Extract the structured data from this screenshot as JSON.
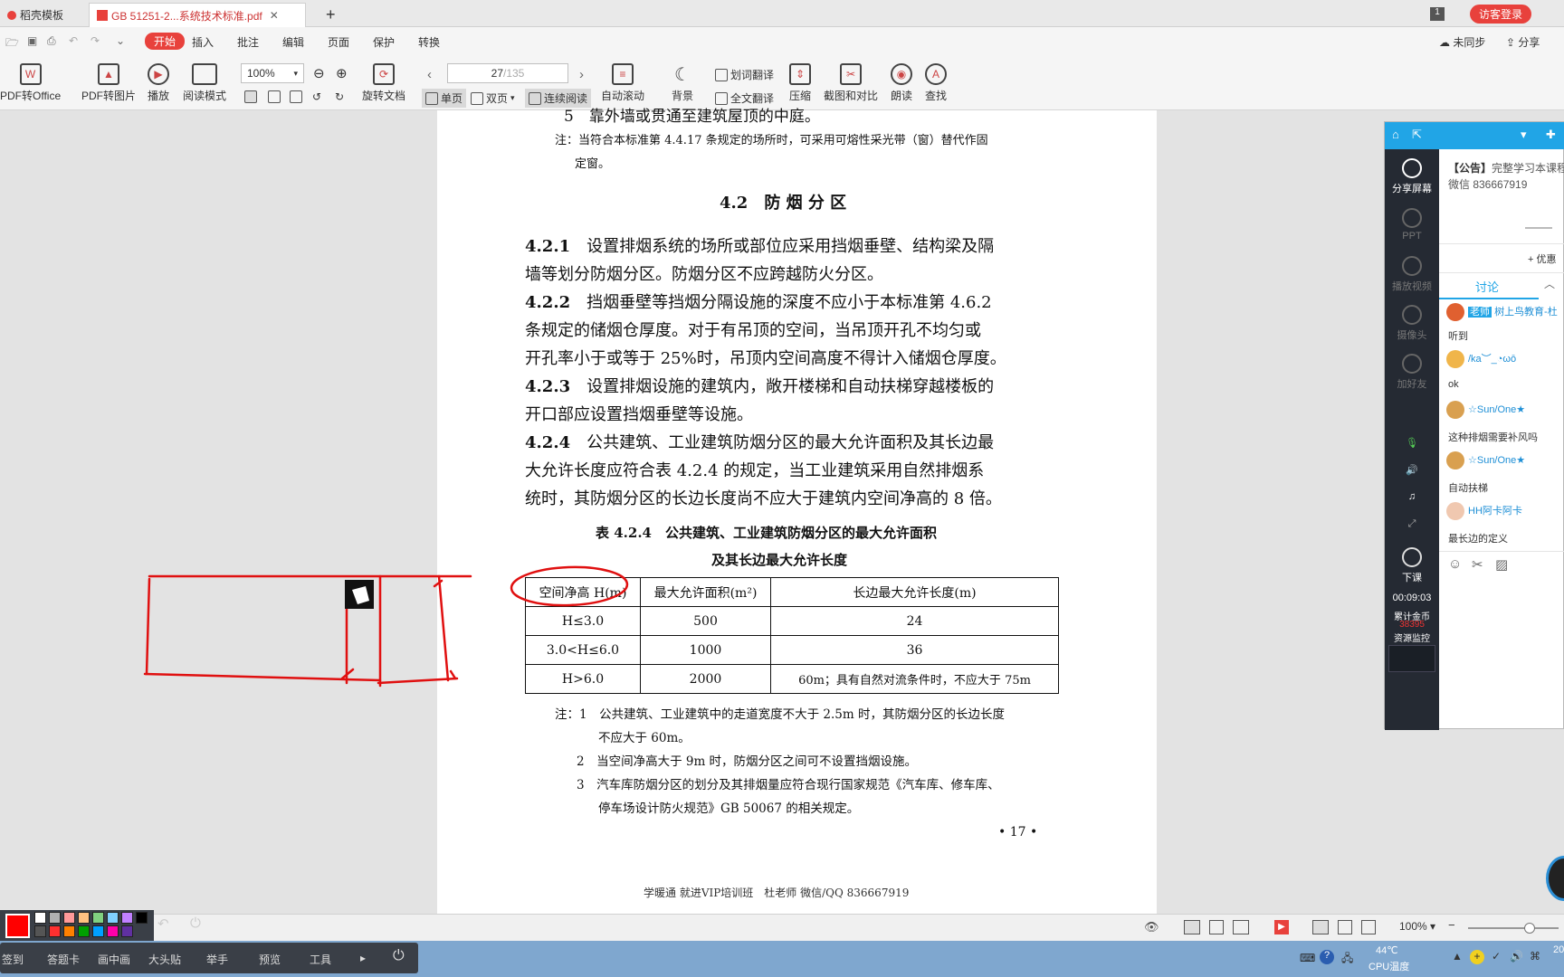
{
  "tabs": {
    "home": "稻壳模板",
    "pdf": "GB 51251-2...系统技术标准.pdf",
    "add": "+",
    "badge": "1",
    "login": "访客登录"
  },
  "menu": {
    "items": [
      "开始",
      "插入",
      "批注",
      "编辑",
      "页面",
      "保护",
      "转换"
    ],
    "sync": "未同步",
    "share": "分享"
  },
  "ribbon": {
    "pdf_to_office": "PDF转Office",
    "pdf_to_image": "PDF转图片",
    "play": "播放",
    "read_mode": "阅读模式",
    "zoom": "100%",
    "rotate": "旋转文档",
    "page_current": "27",
    "page_total": "/135",
    "single": "单页",
    "double": "双页",
    "continuous": "连续阅读",
    "auto_scroll": "自动滚动",
    "background": "背景",
    "word_translate": "划词翻译",
    "full_translate": "全文翻译",
    "compress": "压缩",
    "screenshot_compare": "截图和对比",
    "read_aloud": "朗读",
    "find": "查找"
  },
  "doc": {
    "top_line": "5　靠外墙或贯通至建筑屋顶的中庭。",
    "note_top_1": "注：当符合本标准第 4.4.17 条规定的场所时，可采用可熔性采光带（窗）替代作固",
    "note_top_2": "定窗。",
    "section_title": "4.2　防 烟 分 区",
    "p421_num": "4.2.1",
    "p421_l1": "设置排烟系统的场所或部位应采用挡烟垂壁、结构梁及隔",
    "p421_l2": "墙等划分防烟分区。防烟分区不应跨越防火分区。",
    "p422_num": "4.2.2",
    "p422_l1": "挡烟垂壁等挡烟分隔设施的深度不应小于本标准第 4.6.2",
    "p422_l2": "条规定的储烟仓厚度。对于有吊顶的空间，当吊顶开孔不均匀或",
    "p422_l3": "开孔率小于或等于 25%时，吊顶内空间高度不得计入储烟仓厚度。",
    "p423_num": "4.2.3",
    "p423_l1": "设置排烟设施的建筑内，敞开楼梯和自动扶梯穿越楼板的",
    "p423_l2": "开口部应设置挡烟垂壁等设施。",
    "p424_num": "4.2.4",
    "p424_l1": "公共建筑、工业建筑防烟分区的最大允许面积及其长边最",
    "p424_l2": "大允许长度应符合表 4.2.4 的规定，当工业建筑采用自然排烟系",
    "p424_l3": "统时，其防烟分区的长边长度尚不应大于建筑内空间净高的 8 倍。",
    "table_title_1": "表 4.2.4　公共建筑、工业建筑防烟分区的最大允许面积",
    "table_title_2": "及其长边最大允许长度",
    "table_header": [
      "空间净高 H(m)",
      "最大允许面积(m²)",
      "长边最大允许长度(m)"
    ],
    "table_rows": [
      [
        "H≤3.0",
        "500",
        "24"
      ],
      [
        "3.0<H≤6.0",
        "1000",
        "36"
      ],
      [
        "H>6.0",
        "2000",
        "60m；具有自然对流条件时，不应大于 75m"
      ]
    ],
    "note_1a": "注：1　公共建筑、工业建筑中的走道宽度不大于 2.5m 时，其防烟分区的长边长度",
    "note_1b": "不应大于 60m。",
    "note_2": "2　当空间净高大于 9m 时，防烟分区之间可不设置挡烟设施。",
    "note_3a": "3　汽车库防烟分区的划分及其排烟量应符合现行国家规范《汽车库、修车库、",
    "note_3b": "停车场设计防火规范》GB 50067 的相关规定。",
    "page_number": "• 17 •",
    "footer": "学暖通 就进VIP培训班　杜老师 微信/QQ 836667919"
  },
  "live": {
    "side": [
      "分享屏幕",
      "PPT",
      "播放视频",
      "摄像头",
      "加好友"
    ],
    "notice_label": "【公告】",
    "notice_text": "完整学习本课程",
    "notice_wechat": "微信 836667919",
    "promo": "+ 优惠",
    "discuss_tab": "讨论",
    "chat": [
      {
        "name": "老师",
        "name2": "树上鸟教育-杜",
        "msg": "听到"
      },
      {
        "name": "/ka︶_◔ωō",
        "msg": "ok"
      },
      {
        "name": "☆Sun/One★",
        "msg": "这种排烟需要补风吗"
      },
      {
        "name": "☆Sun/One★",
        "msg": "自动扶梯"
      },
      {
        "name": "HH阿卡阿卡",
        "msg": "最长边的定义"
      }
    ],
    "end_class": "下课",
    "timer": "00:09:03",
    "accumulated": "累计金币",
    "coins": "38395",
    "monitor": "资源监控"
  },
  "status": {
    "zoom": "100%"
  },
  "tray": {
    "temp": "44℃",
    "cpu": "CPU温度",
    "year": "20"
  },
  "screen_tools": [
    "签到",
    "答题卡",
    "画中画",
    "大头贴",
    "举手",
    "预览",
    "工具"
  ],
  "palette": {
    "colors": [
      "#ff0000",
      "#ffffff",
      "#b0b0b0",
      "#ff9999",
      "#ffc080",
      "#80d080",
      "#80d0ff",
      "#c080ff",
      "#000000",
      "#555555",
      "#ff3030",
      "#ff8000",
      "#00a000",
      "#00a0ff",
      "#ff00aa",
      "#6030a0"
    ]
  }
}
